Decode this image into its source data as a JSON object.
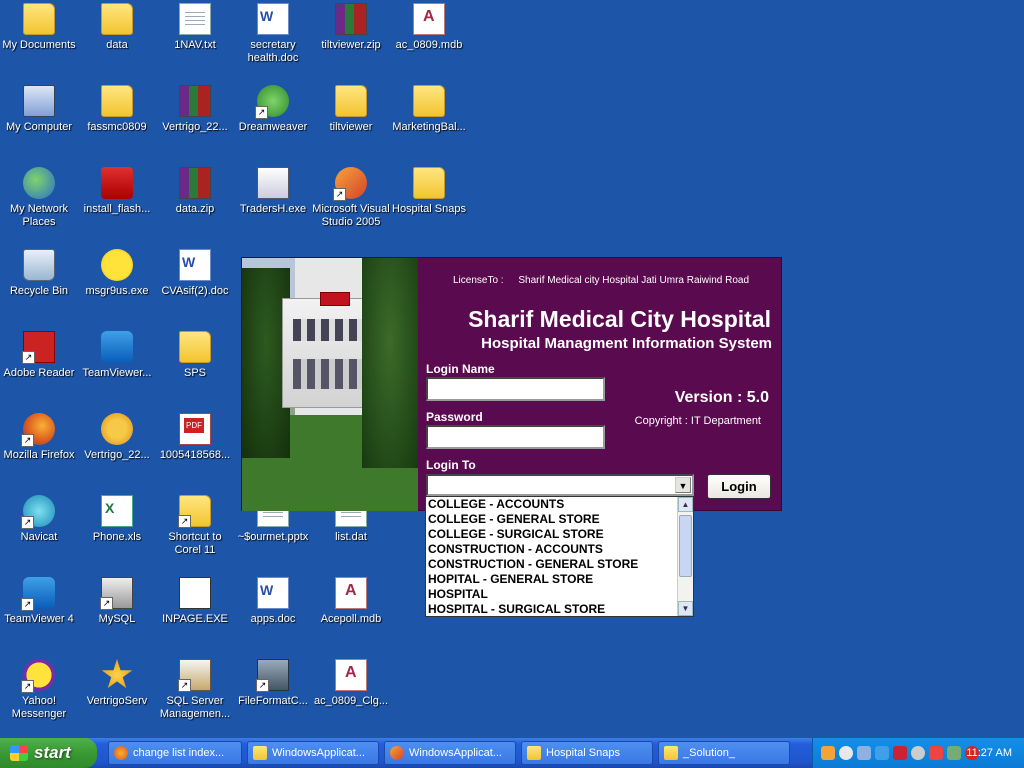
{
  "desktop_icons": [
    {
      "label": "My Documents",
      "icon": "my-documents-icon"
    },
    {
      "label": "data",
      "icon": "folder-icon"
    },
    {
      "label": "1NAV.txt",
      "icon": "text-file-icon"
    },
    {
      "label": "secretary health.doc",
      "icon": "word-doc-icon"
    },
    {
      "label": "tiltviewer.zip",
      "icon": "winrar-archive-icon"
    },
    {
      "label": "ac_0809.mdb",
      "icon": "access-db-icon"
    },
    {
      "label": "My Computer",
      "icon": "my-computer-icon"
    },
    {
      "label": "fassmc0809",
      "icon": "folder-icon"
    },
    {
      "label": "Vertrigo_22...",
      "icon": "winrar-archive-icon"
    },
    {
      "label": "Dreamweaver",
      "icon": "dreamweaver-icon"
    },
    {
      "label": "tiltviewer",
      "icon": "folder-icon"
    },
    {
      "label": "MarketingBal...",
      "icon": "folder-icon"
    },
    {
      "label": "My Network Places",
      "icon": "network-places-icon"
    },
    {
      "label": "install_flash...",
      "icon": "flash-installer-icon"
    },
    {
      "label": "data.zip",
      "icon": "winrar-archive-icon"
    },
    {
      "label": "TradersH.exe",
      "icon": "exe-icon"
    },
    {
      "label": "Microsoft Visual Studio 2005",
      "icon": "visual-studio-icon"
    },
    {
      "label": "Hospital Snaps",
      "icon": "folder-icon"
    },
    {
      "label": "Recycle Bin",
      "icon": "recycle-bin-icon"
    },
    {
      "label": "msgr9us.exe",
      "icon": "messenger-installer-icon"
    },
    {
      "label": "CVAsif(2).doc",
      "icon": "word-doc-icon"
    },
    {
      "label": "Adobe Reader",
      "icon": "adobe-reader-icon"
    },
    {
      "label": "TeamViewer...",
      "icon": "teamviewer-icon"
    },
    {
      "label": "SPS",
      "icon": "folder-icon"
    },
    {
      "label": "Mozilla Firefox",
      "icon": "firefox-icon"
    },
    {
      "label": "Vertrigo_22...",
      "icon": "gear-icon"
    },
    {
      "label": "1005418568...",
      "icon": "pdf-icon"
    },
    {
      "label": "Navicat",
      "icon": "navicat-icon"
    },
    {
      "label": "Phone.xls",
      "icon": "excel-icon"
    },
    {
      "label": "Shortcut to Corel 11",
      "icon": "folder-icon"
    },
    {
      "label": "~$ourmet.pptx",
      "icon": "doc-file-icon"
    },
    {
      "label": "list.dat",
      "icon": "dat-file-icon"
    },
    {
      "label": "TeamViewer 4",
      "icon": "teamviewer-icon"
    },
    {
      "label": "MySQL",
      "icon": "mysql-icon"
    },
    {
      "label": "INPAGE.EXE",
      "icon": "inpage-icon"
    },
    {
      "label": "apps.doc",
      "icon": "word-doc-icon"
    },
    {
      "label": "Acepoll.mdb",
      "icon": "access-db-icon"
    },
    {
      "label": "Yahoo! Messenger",
      "icon": "yahoo-messenger-icon"
    },
    {
      "label": "VertrigoServ",
      "icon": "vertrigo-star-icon"
    },
    {
      "label": "SQL Server Managemen...",
      "icon": "sql-server-icon"
    },
    {
      "label": "FileFormatC...",
      "icon": "file-format-converter-icon"
    },
    {
      "label": "ac_0809_Clg...",
      "icon": "access-db-icon"
    }
  ],
  "login_window": {
    "license_key": "LicenseTo :",
    "license_value": "Sharif Medical city Hospital Jati Umra Raiwind Road",
    "hospital_name": "Sharif Medical City Hospital",
    "subtitle": "Hospital Managment Information System",
    "login_name_label": "Login Name",
    "login_name_value": "",
    "password_label": "Password",
    "password_value": "",
    "login_to_label": "Login To",
    "login_to_value": "",
    "version": "Version : 5.0",
    "copyright": "Copyright : IT Department",
    "login_button": "Login",
    "dropdown_options": [
      "COLLEGE - ACCOUNTS",
      "COLLEGE - GENERAL STORE",
      "COLLEGE - SURGICAL STORE",
      "CONSTRUCTION - ACCOUNTS",
      "CONSTRUCTION - GENERAL STORE",
      "HOPITAL - GENERAL STORE",
      "HOSPITAL",
      "HOSPITAL - SURGICAL STORE"
    ]
  },
  "taskbar": {
    "start_label": "start",
    "tasks": [
      {
        "label": "change list index...",
        "icon": "firefox-icon"
      },
      {
        "label": "WindowsApplicat...",
        "icon": "folder-icon"
      },
      {
        "label": "WindowsApplicat...",
        "icon": "visual-studio-icon"
      },
      {
        "label": "Hospital Snaps",
        "icon": "folder-icon"
      },
      {
        "label": "_Solution_",
        "icon": "folder-icon"
      }
    ],
    "clock": "11:27 AM"
  },
  "colors": {
    "desktop": "#1d56a9",
    "login_panel": "#5a0a4f",
    "taskbar": "#245edb",
    "start_button": "#3a9a34"
  }
}
